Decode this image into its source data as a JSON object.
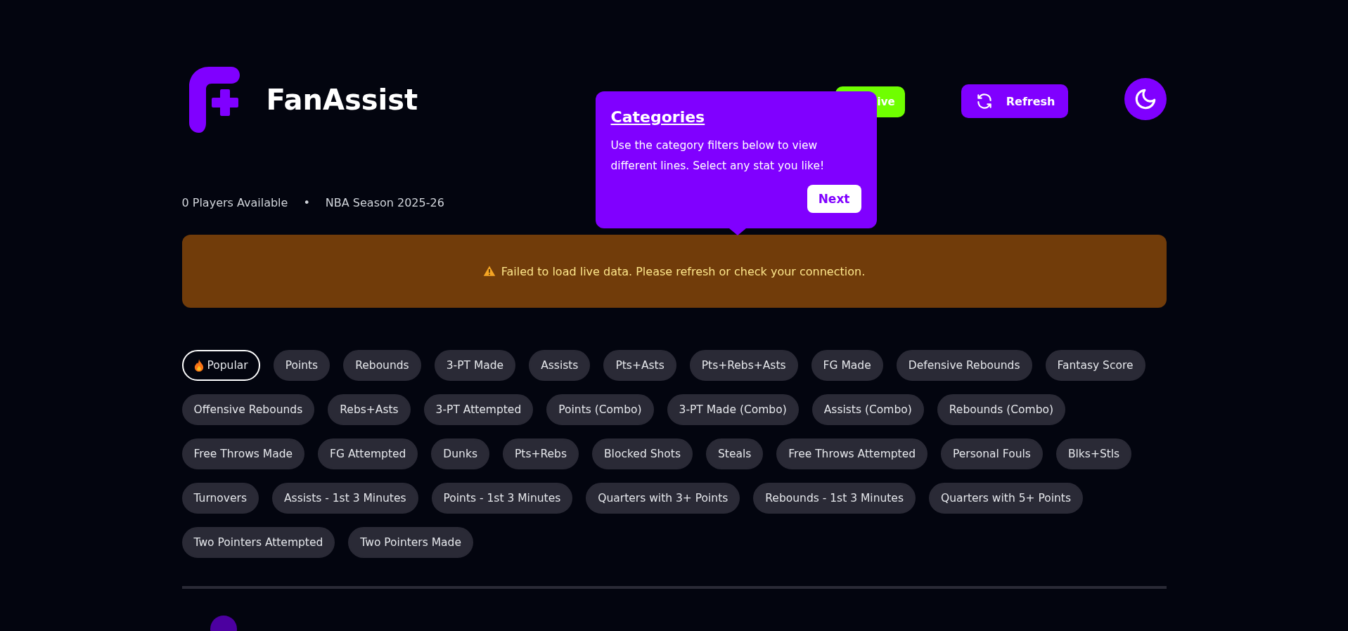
{
  "header": {
    "brand": "FanAssist",
    "live_button": {
      "label": "ive"
    },
    "refresh_button": {
      "label": "Refresh"
    }
  },
  "meta": {
    "players": "0 Players Available",
    "separator": "•",
    "season": "NBA Season 2025-26"
  },
  "tooltip": {
    "title": "Categories",
    "body": "Use the category filters below to view different lines. Select any stat you like!",
    "button": "Next"
  },
  "alert": {
    "message": "Failed to load live data. Please refresh or check your connection."
  },
  "categories": [
    {
      "label": "Popular",
      "selected": true,
      "hot": true
    },
    {
      "label": "Points",
      "selected": false
    },
    {
      "label": "Rebounds",
      "selected": false
    },
    {
      "label": "3-PT Made",
      "selected": false
    },
    {
      "label": "Assists",
      "selected": false
    },
    {
      "label": "Pts+Asts",
      "selected": false
    },
    {
      "label": "Pts+Rebs+Asts",
      "selected": false
    },
    {
      "label": "FG Made",
      "selected": false
    },
    {
      "label": "Defensive Rebounds",
      "selected": false
    },
    {
      "label": "Fantasy Score",
      "selected": false
    },
    {
      "label": "Offensive Rebounds",
      "selected": false
    },
    {
      "label": "Rebs+Asts",
      "selected": false
    },
    {
      "label": "3-PT Attempted",
      "selected": false
    },
    {
      "label": "Points (Combo)",
      "selected": false
    },
    {
      "label": "3-PT Made (Combo)",
      "selected": false
    },
    {
      "label": "Assists (Combo)",
      "selected": false
    },
    {
      "label": "Rebounds (Combo)",
      "selected": false
    },
    {
      "label": "Free Throws Made",
      "selected": false
    },
    {
      "label": "FG Attempted",
      "selected": false
    },
    {
      "label": "Dunks",
      "selected": false
    },
    {
      "label": "Pts+Rebs",
      "selected": false
    },
    {
      "label": "Blocked Shots",
      "selected": false
    },
    {
      "label": "Steals",
      "selected": false
    },
    {
      "label": "Free Throws Attempted",
      "selected": false
    },
    {
      "label": "Personal Fouls",
      "selected": false
    },
    {
      "label": "Blks+Stls",
      "selected": false
    },
    {
      "label": "Turnovers",
      "selected": false
    },
    {
      "label": "Assists - 1st 3 Minutes",
      "selected": false
    },
    {
      "label": "Points - 1st 3 Minutes",
      "selected": false
    },
    {
      "label": "Quarters with 3+ Points",
      "selected": false
    },
    {
      "label": "Rebounds - 1st 3 Minutes",
      "selected": false
    },
    {
      "label": "Quarters with 5+ Points",
      "selected": false
    },
    {
      "label": "Two Pointers Attempted",
      "selected": false
    },
    {
      "label": "Two Pointers Made",
      "selected": false
    }
  ]
}
